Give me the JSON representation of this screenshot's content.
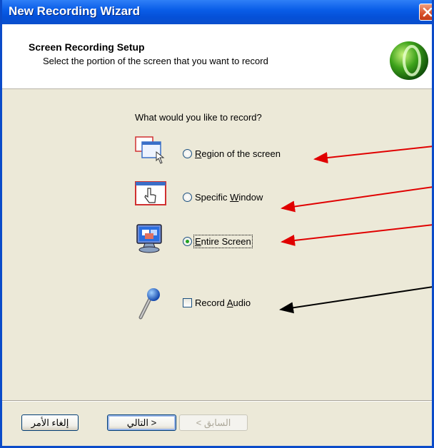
{
  "window": {
    "title": "New Recording Wizard"
  },
  "header": {
    "title": "Screen Recording Setup",
    "subtitle": "Select the portion of the screen that you want to record"
  },
  "question": "What would you like to record?",
  "options": [
    {
      "label_pre": "",
      "label_accel": "R",
      "label_post": "egion of the screen",
      "selected": false,
      "icon": "region-cursor-icon"
    },
    {
      "label_pre": "Specific ",
      "label_accel": "W",
      "label_post": "indow",
      "selected": false,
      "icon": "window-hand-icon"
    },
    {
      "label_pre": "",
      "label_accel": "E",
      "label_post": "ntire Screen",
      "selected": true,
      "icon": "monitor-icon"
    }
  ],
  "audio": {
    "label_pre": "Record ",
    "label_accel": "A",
    "label_post": "udio",
    "checked": false,
    "icon": "microphone-icon"
  },
  "buttons": {
    "cancel": "إلغاء الأمر",
    "next": "التالي >",
    "back": "< السابق"
  },
  "colors": {
    "arrow_red": "#e00000",
    "arrow_black": "#000000",
    "titlebar": "#0a5ee8"
  }
}
